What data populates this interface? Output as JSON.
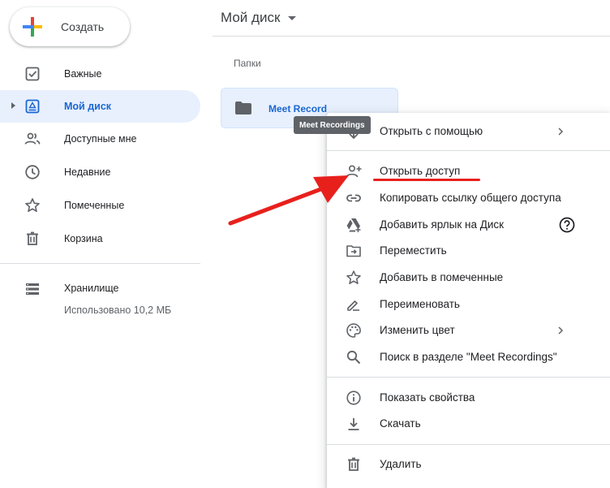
{
  "create": {
    "label": "Создать"
  },
  "sidebar": {
    "items": [
      {
        "label": "Важные",
        "icon": "check-square-icon"
      },
      {
        "label": "Мой диск",
        "icon": "my-drive-icon",
        "active": true
      },
      {
        "label": "Доступные мне",
        "icon": "shared-people-icon"
      },
      {
        "label": "Недавние",
        "icon": "clock-icon"
      },
      {
        "label": "Помеченные",
        "icon": "star-icon"
      },
      {
        "label": "Корзина",
        "icon": "trash-icon"
      }
    ],
    "storage": {
      "label": "Хранилище",
      "used": "Использовано 10,2 МБ",
      "icon": "storage-icon"
    }
  },
  "main": {
    "title": "Мой диск",
    "section_label": "Папки",
    "folder": {
      "name": "Meet Recordings"
    },
    "tooltip": "Meet Recordings"
  },
  "context_menu": {
    "items": [
      {
        "label": "Открыть с помощью",
        "icon": "open-with-icon"
      },
      {
        "label": "Открыть доступ",
        "icon": "person-add-icon"
      },
      {
        "label": "Копировать ссылку общего доступа",
        "icon": "link-icon"
      },
      {
        "label": "Добавить ярлык на Диск",
        "icon": "drive-shortcut-icon"
      },
      {
        "label": "Переместить",
        "icon": "move-folder-icon"
      },
      {
        "label": "Добавить в помеченные",
        "icon": "star-outline-icon"
      },
      {
        "label": "Переименовать",
        "icon": "pencil-icon"
      },
      {
        "label": "Изменить цвет",
        "icon": "palette-icon"
      },
      {
        "label": "Поиск в разделе \"Meet Recordings\"",
        "icon": "search-icon"
      },
      {
        "label": "Показать свойства",
        "icon": "info-icon"
      },
      {
        "label": "Скачать",
        "icon": "download-icon"
      },
      {
        "label": "Удалить",
        "icon": "trash-icon"
      }
    ]
  },
  "colors": {
    "accent": "#1967d2",
    "active_bg": "#e8f0fe",
    "annotation_red": "#e8201c"
  }
}
